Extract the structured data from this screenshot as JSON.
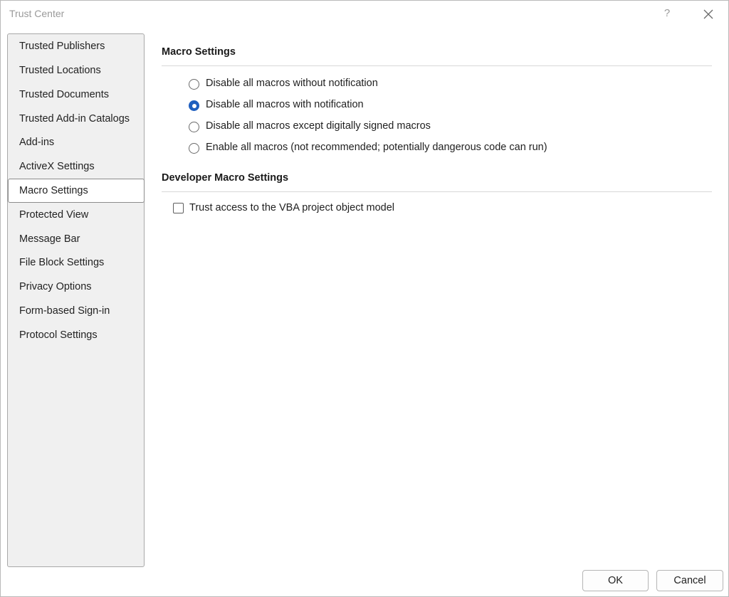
{
  "window": {
    "title": "Trust Center",
    "help_label": "?"
  },
  "sidebar": {
    "items": [
      {
        "label": "Trusted Publishers"
      },
      {
        "label": "Trusted Locations"
      },
      {
        "label": "Trusted Documents"
      },
      {
        "label": "Trusted Add-in Catalogs"
      },
      {
        "label": "Add-ins"
      },
      {
        "label": "ActiveX Settings"
      },
      {
        "label": "Macro Settings",
        "selected": true
      },
      {
        "label": "Protected View"
      },
      {
        "label": "Message Bar"
      },
      {
        "label": "File Block Settings"
      },
      {
        "label": "Privacy Options"
      },
      {
        "label": "Form-based Sign-in"
      },
      {
        "label": "Protocol Settings"
      }
    ]
  },
  "macro_settings": {
    "title": "Macro Settings",
    "options": [
      {
        "label": "Disable all macros without notification",
        "checked": false
      },
      {
        "label": "Disable all macros with notification",
        "checked": true
      },
      {
        "label": "Disable all macros except digitally signed macros",
        "checked": false
      },
      {
        "label": "Enable all macros (not recommended; potentially dangerous code can run)",
        "checked": false
      }
    ]
  },
  "developer_settings": {
    "title": "Developer Macro Settings",
    "trust_vba_label": "Trust access to the VBA project object model",
    "trust_vba_checked": false
  },
  "footer": {
    "ok_label": "OK",
    "cancel_label": "Cancel"
  },
  "colors": {
    "accent": "#1f5fbf",
    "sidebar_bg": "#f0f0f0"
  }
}
